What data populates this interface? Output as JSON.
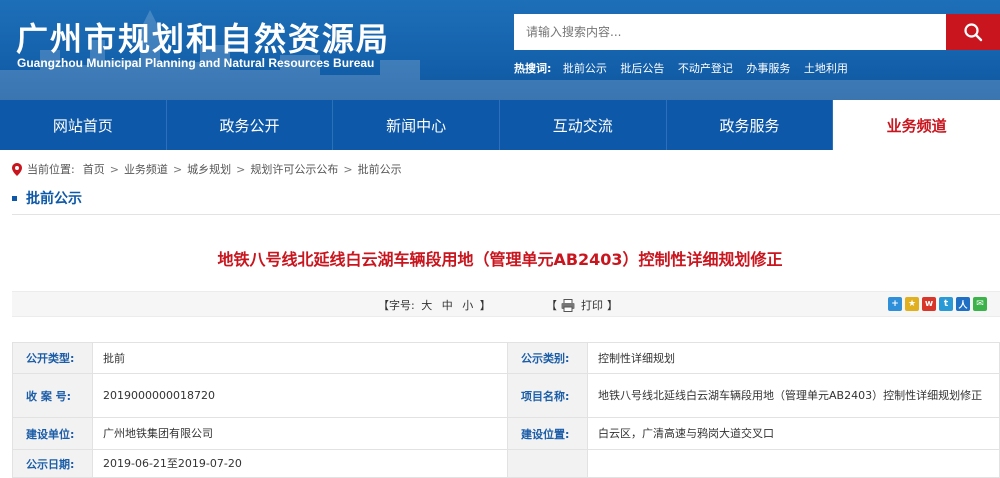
{
  "header": {
    "title_cn": "广州市规划和自然资源局",
    "title_en": "Guangzhou Municipal Planning and Natural Resources Bureau",
    "search_placeholder": "请输入搜索内容...",
    "hot_label": "热搜词:",
    "hot_links": [
      "批前公示",
      "批后公告",
      "不动产登记",
      "办事服务",
      "土地利用"
    ]
  },
  "nav": {
    "items": [
      "网站首页",
      "政务公开",
      "新闻中心",
      "互动交流",
      "政务服务",
      "业务频道"
    ],
    "active_index": 5
  },
  "breadcrumb": {
    "label": "当前位置:",
    "items": [
      "首页",
      "业务频道",
      "城乡规划",
      "规划许可公示公布",
      "批前公示"
    ],
    "separator": ">"
  },
  "section": {
    "title": "批前公示"
  },
  "article": {
    "title": "地铁八号线北延线白云湖车辆段用地（管理单元AB2403）控制性详细规划修正"
  },
  "toolbar": {
    "font_open": "【字号:",
    "font_big": "大",
    "font_mid": "中",
    "font_small": "小",
    "font_close": "】",
    "print_open": "【",
    "print_label": "打印",
    "print_close": "】"
  },
  "info_rows": [
    {
      "k1": "公开类型:",
      "v1": "批前",
      "k2": "公示类别:",
      "v2": "控制性详细规划"
    },
    {
      "k1": "收 案 号:",
      "v1": "2019000000018720",
      "k2": "项目名称:",
      "v2": "地铁八号线北延线白云湖车辆段用地（管理单元AB2403）控制性详细规划修正"
    },
    {
      "k1": "建设单位:",
      "v1": "广州地铁集团有限公司",
      "k2": "建设位置:",
      "v2": "白云区，广清高速与鸦岗大道交叉口"
    },
    {
      "k1": "公示日期:",
      "v1": "2019-06-21至2019-07-20",
      "k2": "",
      "v2": ""
    }
  ],
  "colors": {
    "brand_blue": "#0d58a8",
    "accent_red": "#c9151e"
  }
}
